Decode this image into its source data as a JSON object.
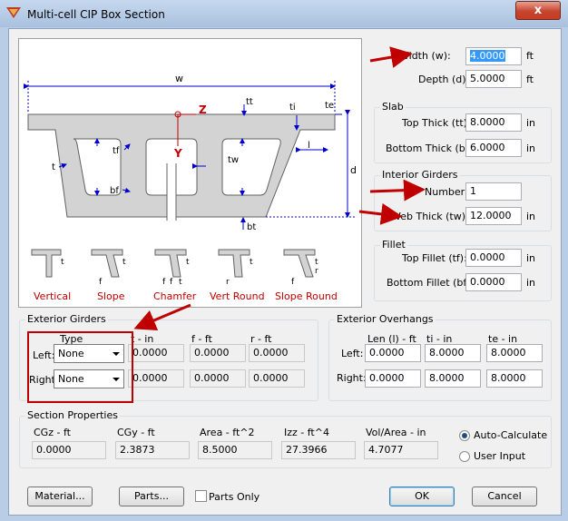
{
  "window": {
    "title": "Multi-cell CIP Box Section",
    "close_label": "x"
  },
  "diagram": {
    "labels": {
      "w": "w",
      "tt": "tt",
      "ti": "ti",
      "te": "te",
      "Z": "Z",
      "Y": "Y",
      "tf": "tf",
      "t": "t",
      "bf": "bf",
      "tw": "tw",
      "l": "l",
      "d": "d",
      "bt": "bt"
    },
    "shapes": [
      {
        "name": "Vertical",
        "labels": [
          "t"
        ]
      },
      {
        "name": "Slope",
        "labels": [
          "t",
          "f"
        ]
      },
      {
        "name": "Chamfer",
        "labels": [
          "t",
          "f",
          "f",
          "t"
        ]
      },
      {
        "name": "Vert Round",
        "labels": [
          "t",
          "r"
        ]
      },
      {
        "name": "Slope Round",
        "labels": [
          "t",
          "r",
          "f"
        ]
      }
    ]
  },
  "dimensions": {
    "width": {
      "label": "Width (w):",
      "value": "4.0000",
      "unit": "ft"
    },
    "depth": {
      "label": "Depth (d):",
      "value": "5.0000",
      "unit": "ft"
    }
  },
  "slab": {
    "title": "Slab",
    "top": {
      "label": "Top Thick (tt):",
      "value": "8.0000",
      "unit": "in"
    },
    "bottom": {
      "label": "Bottom Thick (bt):",
      "value": "6.0000",
      "unit": "in"
    }
  },
  "interior_girders": {
    "title": "Interior Girders",
    "number": {
      "label": "Number:",
      "value": "1"
    },
    "web": {
      "label": "Web Thick (tw):",
      "value": "12.0000",
      "unit": "in"
    }
  },
  "fillet": {
    "title": "Fillet",
    "top": {
      "label": "Top Fillet (tf):",
      "value": "0.0000",
      "unit": "in"
    },
    "bottom": {
      "label": "Bottom Fillet (bf):",
      "value": "0.0000",
      "unit": "in"
    }
  },
  "exterior_girders": {
    "title": "Exterior Girders",
    "headers": [
      "Type",
      "t - in",
      "f - ft",
      "r - ft"
    ],
    "rows": [
      {
        "label": "Left:",
        "type": "None",
        "t": "0.0000",
        "f": "0.0000",
        "r": "0.0000"
      },
      {
        "label": "Right:",
        "type": "None",
        "t": "0.0000",
        "f": "0.0000",
        "r": "0.0000"
      }
    ]
  },
  "exterior_overhangs": {
    "title": "Exterior Overhangs",
    "headers": [
      "Len (l) - ft",
      "ti - in",
      "te - in"
    ],
    "rows": [
      {
        "label": "Left:",
        "len": "0.0000",
        "ti": "8.0000",
        "te": "8.0000"
      },
      {
        "label": "Right:",
        "len": "0.0000",
        "ti": "8.0000",
        "te": "8.0000"
      }
    ]
  },
  "section_properties": {
    "title": "Section Properties",
    "fields": [
      {
        "label": "CGz - ft",
        "value": "0.0000"
      },
      {
        "label": "CGy - ft",
        "value": "2.3873"
      },
      {
        "label": "Area - ft^2",
        "value": "8.5000"
      },
      {
        "label": "Izz - ft^4",
        "value": "27.3966"
      },
      {
        "label": "Vol/Area - in",
        "value": "4.7077"
      }
    ],
    "auto_label": "Auto-Calculate",
    "user_label": "User Input",
    "mode": "Auto-Calculate"
  },
  "buttons": {
    "material": "Material...",
    "parts": "Parts...",
    "parts_only": "Parts Only",
    "ok": "OK",
    "cancel": "Cancel"
  },
  "colors": {
    "annotation": "#c00000",
    "dimension": "#0000cc",
    "section_fill": "#d3d3d3"
  }
}
